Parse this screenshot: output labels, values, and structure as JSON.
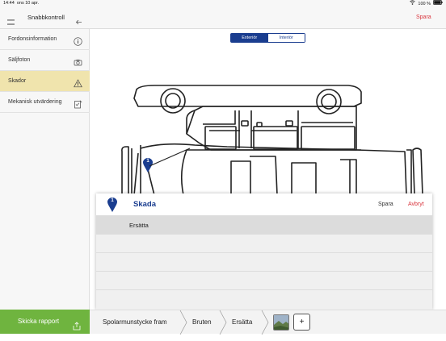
{
  "status": {
    "time": "14:44",
    "date": "ons 10 apr.",
    "battery": "100 %"
  },
  "topbar": {
    "title": "Snabbkontroll",
    "save": "Spara"
  },
  "sidebar": {
    "items": [
      {
        "label": "Fordonsinformation",
        "icon": "info-icon"
      },
      {
        "label": "Säljfoton",
        "icon": "camera-icon"
      },
      {
        "label": "Skador",
        "icon": "warning-icon",
        "active": true
      },
      {
        "label": "Mekanisk utvärdering",
        "icon": "checklist-icon"
      }
    ]
  },
  "segment": {
    "exterior": "Exteriör",
    "interior": "Interiör",
    "selected": "Exteriör"
  },
  "marker": {
    "number": "1"
  },
  "panel": {
    "number": "1",
    "title": "Skada",
    "save": "Spara",
    "cancel": "Avbryt",
    "selected_row": "Ersätta"
  },
  "footer": {
    "send": "Skicka rapport",
    "crumbs": [
      "Spolarmunstycke fram",
      "Bruten",
      "Ersätta"
    ],
    "add": "+"
  },
  "colors": {
    "accent": "#1a3d8f",
    "save_red": "#d9363e",
    "send_green": "#6fb43f",
    "active_bg": "#f0e4ad"
  }
}
